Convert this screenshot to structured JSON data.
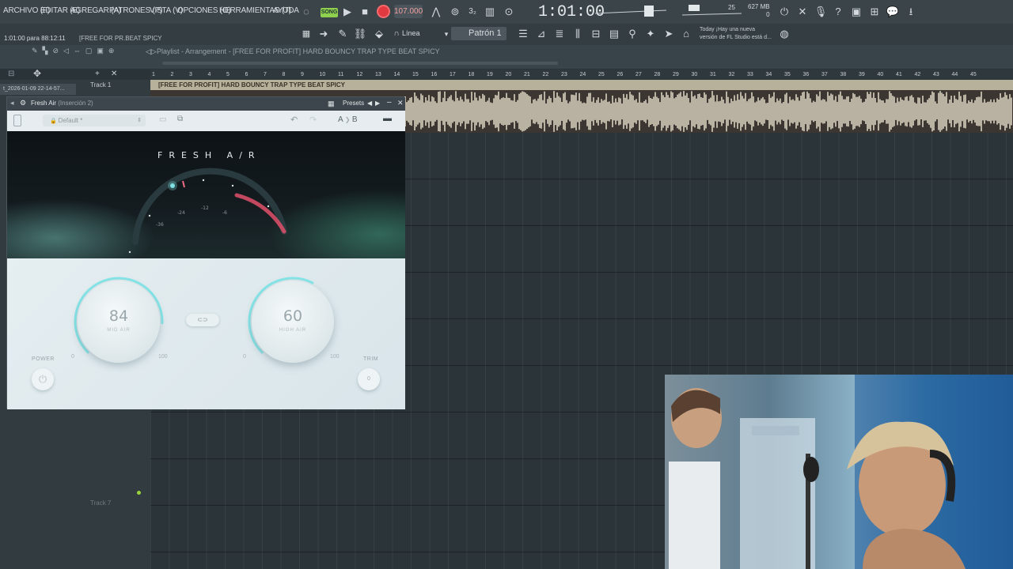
{
  "menubar": {
    "items": [
      "ARCHIVO (F)",
      "EDITAR (E)",
      "AGREGAR (A)",
      "PATRONES (P)",
      "VISTA (V)",
      "OPCIONES (O)",
      "HERRAMIENTAS (T)",
      "AYUDA"
    ],
    "song_mode": "SONG",
    "tempo": "107.000",
    "time": "1:01:00",
    "memory_mb": "627 MB",
    "memory_sub": "0",
    "cpu_value": "25"
  },
  "toolbar2": {
    "hint_position": "1:01:00 para 88:12:11",
    "hint_song": "[FREE FOR PR.BEAT SPICY",
    "snap_mode": "Línea",
    "pattern": "Patrón 1",
    "news_line1": "Today ¡Hay una nueva",
    "news_line2": "versión de FL Studio está d..."
  },
  "playlist": {
    "title": "Playlist - Arrangement",
    "song_name": "[FREE FOR PROFIT] HARD BOUNCY TRAP TYPE BEAT SPICY",
    "clip_name": "[FREE FOR PROFIT] HARD BOUNCY TRAP TYPE BEAT SPICY",
    "sidebar_file": "t_2026-01-09 22-14-57...",
    "track_1": "Track 1",
    "track_7": "Track 7",
    "ruler": [
      "1",
      "2",
      "3",
      "4",
      "5",
      "6",
      "7",
      "8",
      "9",
      "10",
      "11",
      "12",
      "13",
      "14",
      "15",
      "16",
      "17",
      "18",
      "19",
      "20",
      "21",
      "22",
      "23",
      "24",
      "25",
      "26",
      "27",
      "28",
      "29",
      "30",
      "31",
      "32",
      "33",
      "34",
      "35",
      "36",
      "37",
      "38",
      "39",
      "40",
      "41",
      "42",
      "43",
      "44",
      "45"
    ]
  },
  "plugin": {
    "window_title": "Fresh Air",
    "window_subtitle": "(Inserción 2)",
    "presets_label": "Presets",
    "preset_name": "Default *",
    "ab_a": "A",
    "ab_b": "B",
    "logo": "FRESH A/R",
    "meter_labels": [
      "-36",
      "-24",
      "-12",
      "-6"
    ],
    "mid_air": {
      "value": "84",
      "label": "MID AIR",
      "min": "0",
      "max": "100",
      "level": 0.84
    },
    "high_air": {
      "value": "60",
      "label": "HIGH AIR",
      "min": "0",
      "max": "100",
      "level": 0.6
    },
    "power_label": "POWER",
    "trim_label": "TRIM",
    "trim_value": "0",
    "colors": {
      "accent": "#7fe0e3",
      "meter_red": "#e0506a"
    }
  }
}
